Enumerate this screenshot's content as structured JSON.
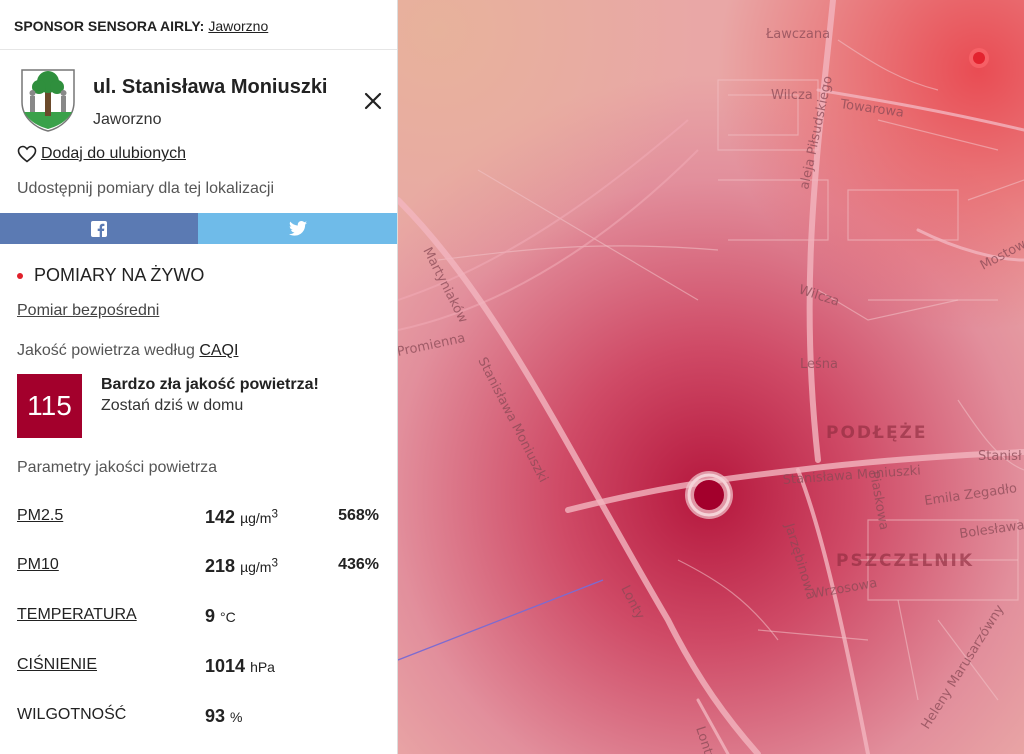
{
  "sponsor": {
    "label": "SPONSOR SENSORA AIRLY:",
    "link": "Jaworzno"
  },
  "location": {
    "title": "ul. Stanisława Moniuszki",
    "city": "Jaworzno"
  },
  "favorites_label": "Dodaj do ulubionych",
  "share_label": "Udostępnij pomiary dla tej lokalizacji",
  "live_label": "POMIARY NA ŻYWO",
  "direct_label": "Pomiar bezpośredni",
  "caqi": {
    "prefix": "Jakość powietrza według",
    "link": "CAQI",
    "value": "115",
    "headline": "Bardzo zła jakość powietrza!",
    "advice": "Zostań dziś w domu",
    "color": "#a3002c"
  },
  "params_label": "Parametry jakości powietrza",
  "params": [
    {
      "name": "PM2.5",
      "value": "142",
      "unit": "µg/m",
      "sup": "3",
      "percent": "568%"
    },
    {
      "name": "PM10",
      "value": "218",
      "unit": "µg/m",
      "sup": "3",
      "percent": "436%"
    },
    {
      "name": "TEMPERATURA",
      "value": "9",
      "unit": "°C",
      "sup": "",
      "percent": ""
    },
    {
      "name": "CIŚNIENIE",
      "value": "1014",
      "unit": "hPa",
      "sup": "",
      "percent": ""
    },
    {
      "name": "WILGOTNOŚĆ",
      "value": "93",
      "unit": "%",
      "sup": "",
      "percent": ""
    }
  ],
  "map": {
    "streets": [
      "Ławczana",
      "Wilcza",
      "Towarowa",
      "aleja Piłsudskiego",
      "Mostowa",
      "Martyniaków",
      "Promienna",
      "Wilcza",
      "Leśna",
      "Stanisława Moniuszki",
      "Stanisława Moniuszki",
      "Stanisł",
      "Piaskowa",
      "Emila Zegadło",
      "Bolesława",
      "Jarzębinowa",
      "Wrzosowa",
      "Lonty",
      "Heleny Marusarzówny",
      "Lonty"
    ],
    "districts": [
      "PODŁĘŻE",
      "PSZCZELNIK"
    ]
  }
}
